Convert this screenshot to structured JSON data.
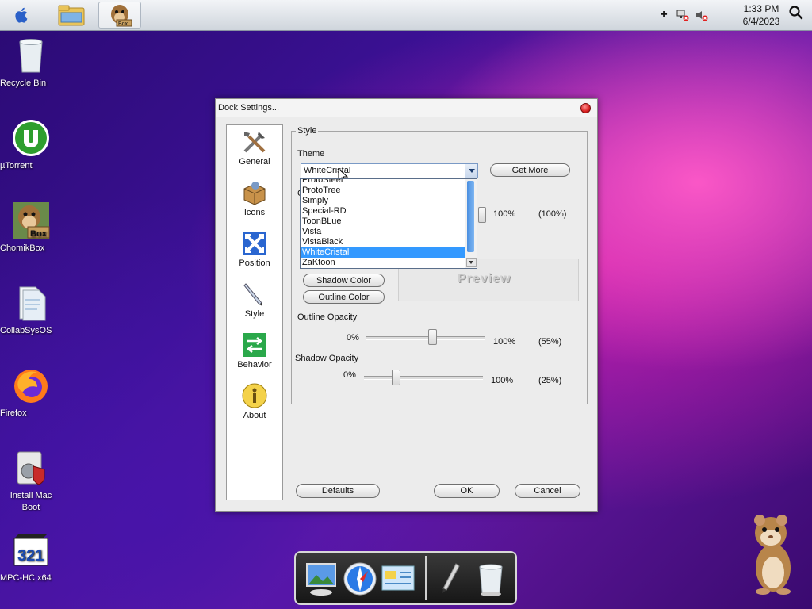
{
  "menubar": {
    "clock_time": "1:33 PM",
    "clock_date": "6/4/2023",
    "plus_label": "+"
  },
  "desktop_icons": [
    {
      "label": "Recycle Bin",
      "icon": "recycle-bin-icon"
    },
    {
      "label": "µTorrent",
      "icon": "utorrent-icon"
    },
    {
      "label": "ChomikBox",
      "icon": "chomikbox-icon"
    },
    {
      "label": "CollabSysOS",
      "icon": "documents-icon"
    },
    {
      "label": "Firefox",
      "icon": "firefox-icon"
    },
    {
      "label": "Install Mac Boot",
      "icon": "installer-icon"
    },
    {
      "label": "MPC-HC x64",
      "icon": "mpc-hc-icon"
    }
  ],
  "dialog": {
    "title": "Dock Settings...",
    "nav": [
      {
        "label": "General",
        "icon": "tools-icon"
      },
      {
        "label": "Icons",
        "icon": "box-icon"
      },
      {
        "label": "Position",
        "icon": "arrows-icon"
      },
      {
        "label": "Style",
        "icon": "pen-icon"
      },
      {
        "label": "Behavior",
        "icon": "swap-icon"
      },
      {
        "label": "About",
        "icon": "info-icon"
      }
    ],
    "group_title": "Style",
    "theme_label": "Theme",
    "theme_value": "WhiteCristal",
    "get_more": "Get More",
    "partial_label": "C",
    "opacity_min": "0%",
    "opacity_max": "100%",
    "opacity_value": "(100%)",
    "shadow_color": "Shadow Color",
    "outline_color": "Outline Color",
    "preview": "Preview",
    "outline_opacity_label": "Outline Opacity",
    "outline_min": "0%",
    "outline_max": "100%",
    "outline_value": "(55%)",
    "shadow_opacity_label": "Shadow Opacity",
    "shadow_min": "0%",
    "shadow_max": "100%",
    "shadow_value": "(25%)",
    "defaults": "Defaults",
    "ok": "OK",
    "cancel": "Cancel",
    "theme_options": [
      "ProtoSteel",
      "ProtoTree",
      "Simply",
      "Special-RD",
      "ToonBLue",
      "Vista",
      "VistaBlack",
      "WhiteCristal",
      "ZaKtoon"
    ],
    "selected_option": "WhiteCristal"
  },
  "dock_items": [
    "photo-app-icon",
    "safari-icon",
    "mail-icon",
    "pen-icon",
    "trash-icon"
  ],
  "colors": {
    "accent": "#3399ff",
    "close": "#d82020"
  }
}
